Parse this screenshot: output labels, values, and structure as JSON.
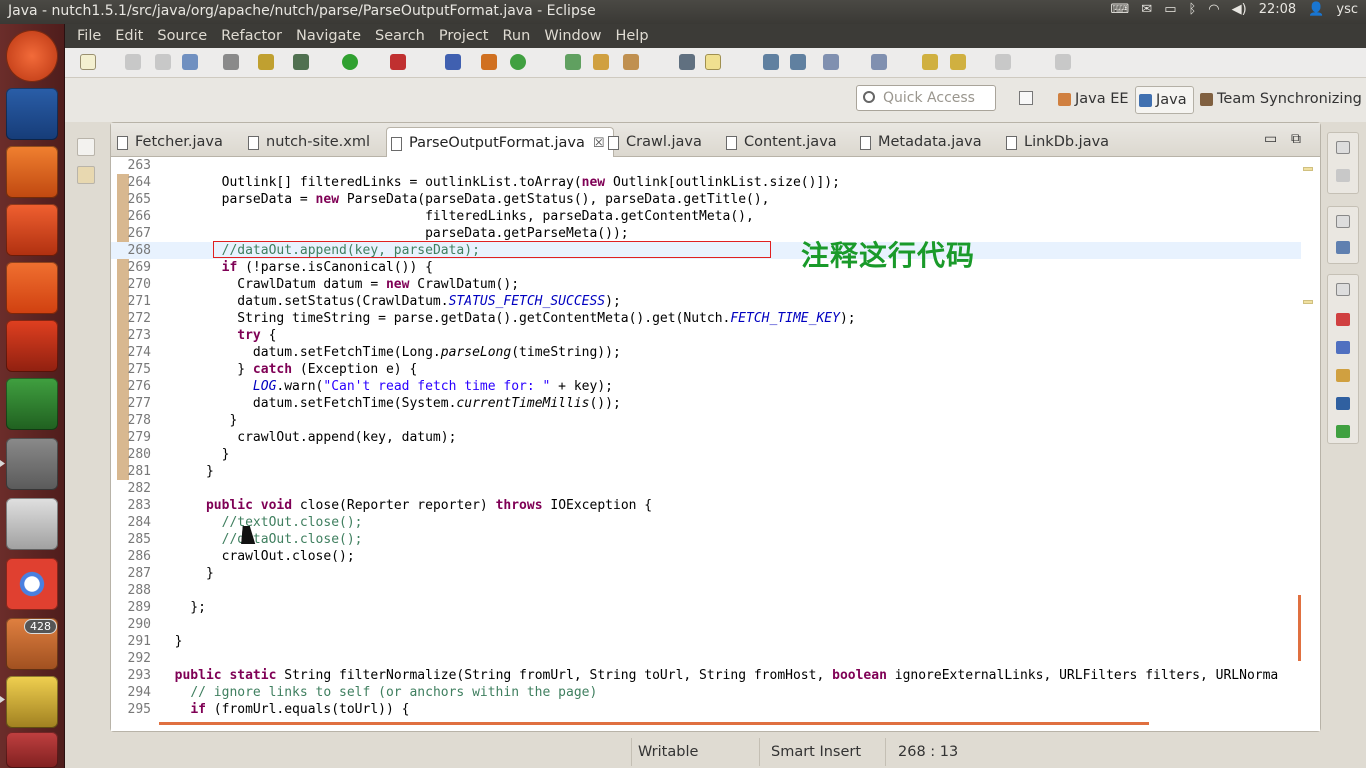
{
  "window": {
    "title": "Java - nutch1.5.1/src/java/org/apache/nutch/parse/ParseOutputFormat.java - Eclipse"
  },
  "tray": {
    "time": "22:08",
    "user": "ysc",
    "keyboard_icon": "keyboard-icon",
    "mail_icon": "mail-icon",
    "battery_icon": "battery-icon",
    "bluetooth_icon": "bluetooth-icon",
    "wifi_icon": "wifi-icon",
    "volume_icon": "volume-icon"
  },
  "launcher": {
    "badge_count": "428"
  },
  "menu": [
    "File",
    "Edit",
    "Source",
    "Refactor",
    "Navigate",
    "Search",
    "Project",
    "Run",
    "Window",
    "Help"
  ],
  "quick_access": {
    "placeholder": "Quick Access"
  },
  "perspectives": [
    "Java EE",
    "Java",
    "Team Synchronizing"
  ],
  "tabs": [
    {
      "label": "Fetcher.java"
    },
    {
      "label": "nutch-site.xml"
    },
    {
      "label": "ParseOutputFormat.java",
      "close": "☒"
    },
    {
      "label": "Crawl.java"
    },
    {
      "label": "Content.java"
    },
    {
      "label": "Metadata.java"
    },
    {
      "label": "LinkDb.java"
    }
  ],
  "annotation": {
    "text": "注释这行代码",
    "color": "#1a9a2a"
  },
  "status": {
    "writable": "Writable",
    "insert": "Smart Insert",
    "position": "268 : 13"
  },
  "code_lines": [
    {
      "n": "263",
      "t": ""
    },
    {
      "n": "264",
      "t": "        Outlink[] filteredLinks = outlinkList.toArray(new Outlink[outlinkList.size()]);"
    },
    {
      "n": "265",
      "t": "        parseData = new ParseData(parseData.getStatus(), parseData.getTitle(),"
    },
    {
      "n": "266",
      "t": "                                  filteredLinks, parseData.getContentMeta(),"
    },
    {
      "n": "267",
      "t": "                                  parseData.getParseMeta());"
    },
    {
      "n": "268",
      "t": "        //dataOut.append(key, parseData);"
    },
    {
      "n": "269",
      "t": "        if (!parse.isCanonical()) {"
    },
    {
      "n": "270",
      "t": "          CrawlDatum datum = new CrawlDatum();"
    },
    {
      "n": "271",
      "t": "          datum.setStatus(CrawlDatum.STATUS_FETCH_SUCCESS);"
    },
    {
      "n": "272",
      "t": "          String timeString = parse.getData().getContentMeta().get(Nutch.FETCH_TIME_KEY);"
    },
    {
      "n": "273",
      "t": "          try {"
    },
    {
      "n": "274",
      "t": "            datum.setFetchTime(Long.parseLong(timeString));"
    },
    {
      "n": "275",
      "t": "          } catch (Exception e) {"
    },
    {
      "n": "276",
      "t": "            LOG.warn(\"Can't read fetch time for: \" + key);"
    },
    {
      "n": "277",
      "t": "            datum.setFetchTime(System.currentTimeMillis());"
    },
    {
      "n": "278",
      "t": "         }"
    },
    {
      "n": "279",
      "t": "          crawlOut.append(key, datum);"
    },
    {
      "n": "280",
      "t": "        }"
    },
    {
      "n": "281",
      "t": "      }"
    },
    {
      "n": "282",
      "t": ""
    },
    {
      "n": "283",
      "t": "      public void close(Reporter reporter) throws IOException {"
    },
    {
      "n": "284",
      "t": "        //textOut.close();"
    },
    {
      "n": "285",
      "t": "        //dataOut.close();"
    },
    {
      "n": "286",
      "t": "        crawlOut.close();"
    },
    {
      "n": "287",
      "t": "      }"
    },
    {
      "n": "288",
      "t": ""
    },
    {
      "n": "289",
      "t": "    };"
    },
    {
      "n": "290",
      "t": ""
    },
    {
      "n": "291",
      "t": "  }"
    },
    {
      "n": "292",
      "t": ""
    },
    {
      "n": "293",
      "t": "  public static String filterNormalize(String fromUrl, String toUrl, String fromHost, boolean ignoreExternalLinks, URLFilters filters, URLNorma"
    },
    {
      "n": "294",
      "t": "    // ignore links to self (or anchors within the page)"
    },
    {
      "n": "295",
      "t": "    if (fromUrl.equals(toUrl)) {"
    }
  ],
  "colors": {
    "keyword": "#7f0055",
    "comment": "#3f7f5f",
    "string": "#2a00ff",
    "field": "#0000c0",
    "launcher": "#5a2220"
  }
}
